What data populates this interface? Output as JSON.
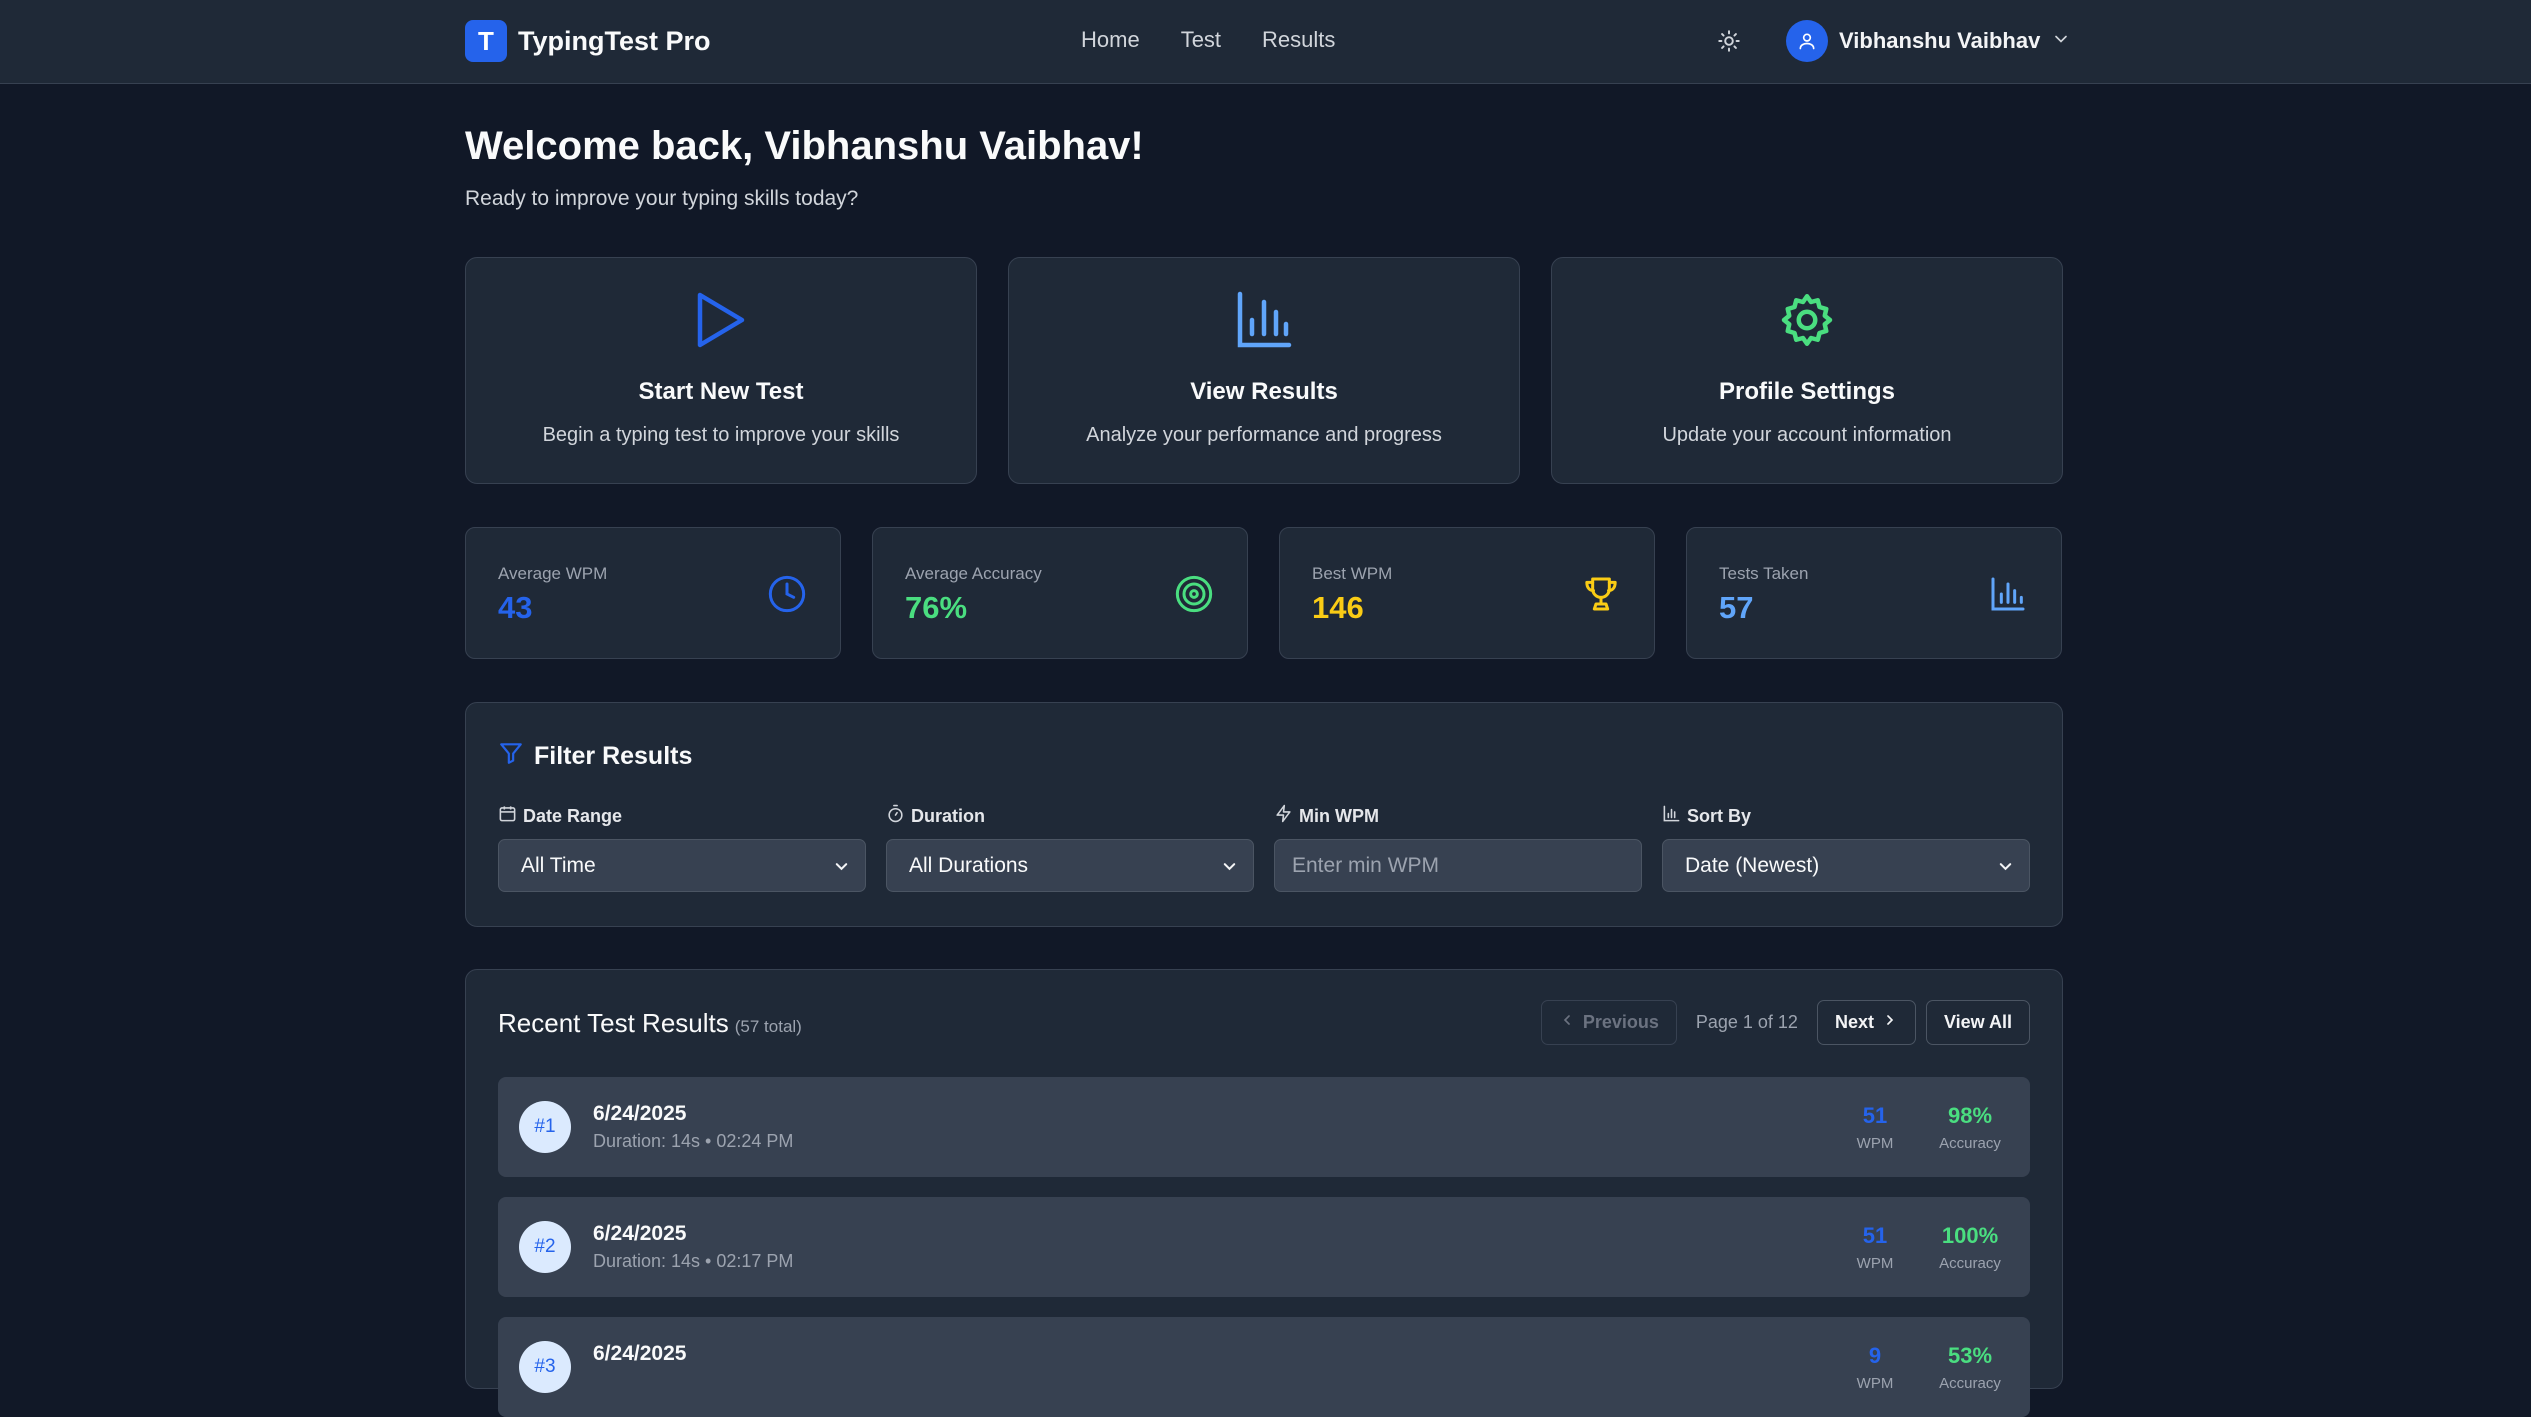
{
  "app": {
    "logo_letter": "T",
    "name": "TypingTest Pro"
  },
  "nav": {
    "links": [
      "Home",
      "Test",
      "Results"
    ],
    "theme_icon": "sun-icon"
  },
  "user": {
    "name": "Vibhanshu Vaibhav"
  },
  "welcome": {
    "title": "Welcome back, Vibhanshu Vaibhav!",
    "subtitle": "Ready to improve your typing skills today?"
  },
  "actions": [
    {
      "title": "Start New Test",
      "desc": "Begin a typing test to improve your skills",
      "icon": "play-icon",
      "color": "#2563eb"
    },
    {
      "title": "View Results",
      "desc": "Analyze your performance and progress",
      "icon": "bar-chart-icon",
      "color": "#60a5fa"
    },
    {
      "title": "Profile Settings",
      "desc": "Update your account information",
      "icon": "gear-icon",
      "color": "#4ade80"
    }
  ],
  "stats": [
    {
      "label": "Average WPM",
      "value": "43",
      "icon": "clock-icon",
      "color": "#2563eb"
    },
    {
      "label": "Average Accuracy",
      "value": "76%",
      "icon": "target-icon",
      "color": "#4ade80"
    },
    {
      "label": "Best WPM",
      "value": "146",
      "icon": "trophy-icon",
      "color": "#facc15"
    },
    {
      "label": "Tests Taken",
      "value": "57",
      "icon": "bar-chart-icon",
      "color": "#60a5fa"
    }
  ],
  "filters": {
    "title": "Filter Results",
    "date_range": {
      "label": "Date Range",
      "value": "All Time"
    },
    "duration": {
      "label": "Duration",
      "value": "All Durations"
    },
    "min_wpm": {
      "label": "Min WPM",
      "placeholder": "Enter min WPM"
    },
    "sort_by": {
      "label": "Sort By",
      "value": "Date (Newest)"
    }
  },
  "results": {
    "title": "Recent Test Results",
    "count": "(57 total)",
    "previous": "Previous",
    "page_info": "Page 1 of 12",
    "next": "Next",
    "view_all": "View All",
    "wpm_unit": "WPM",
    "acc_unit": "Accuracy",
    "rows": [
      {
        "rank": "#1",
        "date": "6/24/2025",
        "meta": "Duration: 14s • 02:24 PM",
        "wpm": "51",
        "accuracy": "98%"
      },
      {
        "rank": "#2",
        "date": "6/24/2025",
        "meta": "Duration: 14s • 02:17 PM",
        "wpm": "51",
        "accuracy": "100%"
      },
      {
        "rank": "#3",
        "date": "6/24/2025",
        "meta": "",
        "wpm": "9",
        "accuracy": "53%"
      }
    ]
  }
}
